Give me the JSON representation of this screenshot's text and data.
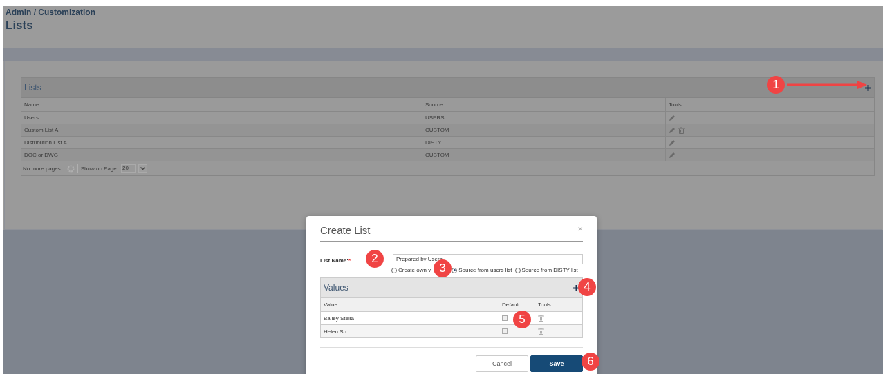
{
  "breadcrumb": "Admin / Customization",
  "page_title": "Lists",
  "lists_panel": {
    "title": "Lists",
    "columns": [
      "Name",
      "Source",
      "Tools"
    ],
    "rows": [
      {
        "name": "Users",
        "source": "USERS",
        "deletable": false
      },
      {
        "name": "Custom List A",
        "source": "CUSTOM",
        "deletable": true
      },
      {
        "name": "Distribution List A",
        "source": "DISTY",
        "deletable": false
      },
      {
        "name": "DOC or DWG",
        "source": "CUSTOM",
        "deletable": false
      }
    ],
    "footer": {
      "pager_text": "No more pages",
      "show_label": "Show on Page:",
      "page_size": "20"
    }
  },
  "dialog": {
    "title": "Create List",
    "close": "×",
    "list_name_label": "List Name:",
    "required_mark": "*",
    "list_name_value": "Prepared by Users",
    "source_options": [
      {
        "label": "Create own v",
        "selected": false
      },
      {
        "label": "Source from users list",
        "selected": true
      },
      {
        "label": "Source from DISTY list",
        "selected": false
      }
    ],
    "values_panel": {
      "title": "Values",
      "columns": [
        "Value",
        "Default",
        "Tools"
      ],
      "rows": [
        {
          "value": "Bailey Stella",
          "default": false
        },
        {
          "value": "Helen Sh",
          "default": false
        }
      ]
    },
    "buttons": [
      {
        "label": "Cancel",
        "kind": "secondary"
      },
      {
        "label": "Save",
        "kind": "primary"
      }
    ]
  },
  "annotations": [
    "1",
    "2",
    "3",
    "4",
    "5",
    "6"
  ]
}
